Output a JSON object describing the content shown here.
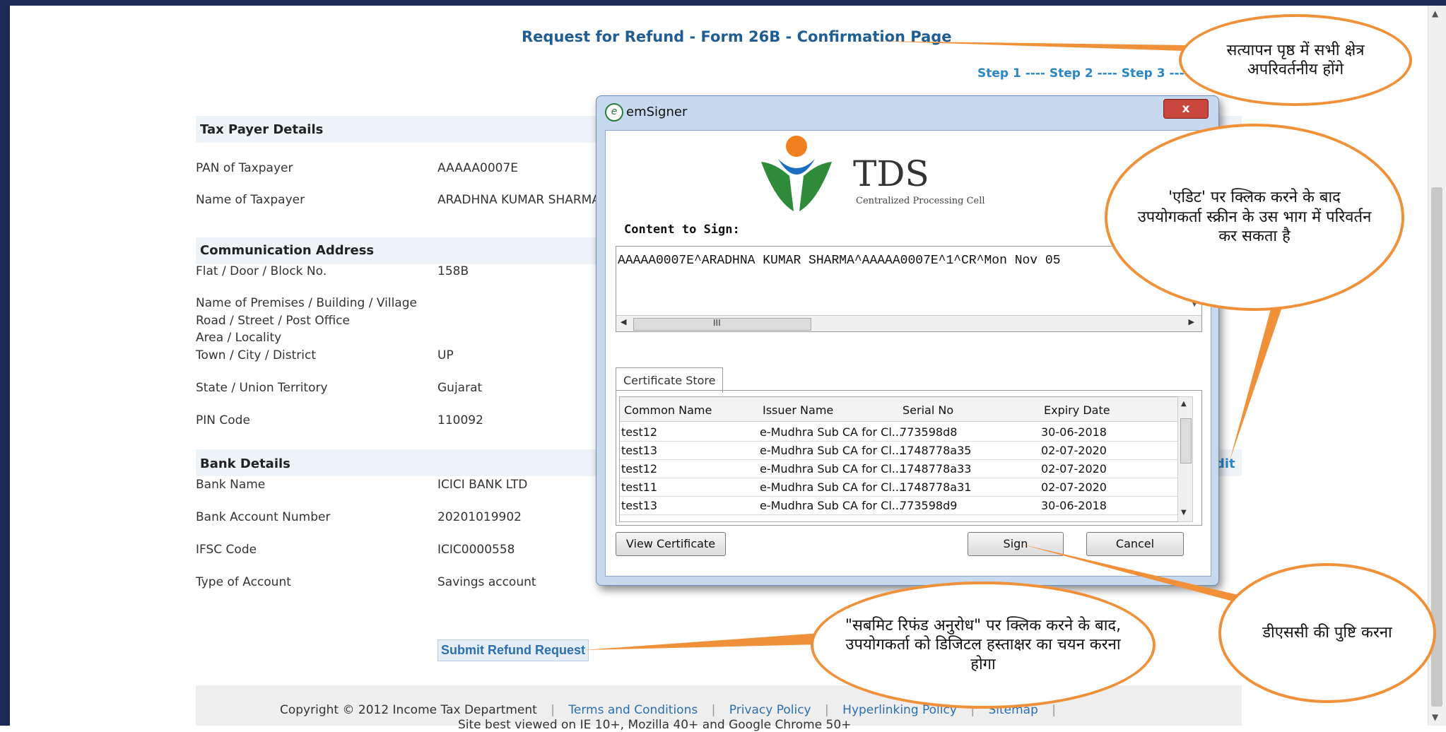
{
  "page": {
    "title": "Request for Refund - Form 26B - Confirmation Page",
    "steps": "Step 1 ---- Step 2 ---- Step 3 ----"
  },
  "taxpayer": {
    "heading": "Tax Payer Details",
    "pan_label": "PAN of Taxpayer",
    "pan_value": "AAAAA0007E",
    "name_label": "Name of Taxpayer",
    "name_value": "ARADHNA KUMAR SHARMA"
  },
  "address": {
    "heading": "Communication Address",
    "flat_label": "Flat / Door / Block No.",
    "flat_value": "158B",
    "premises_label": "Name of Premises / Building / Village",
    "road_label": "Road / Street / Post Office",
    "area_label": "Area / Locality",
    "town_label": "Town / City / District",
    "town_value": "UP",
    "state_label": "State / Union Territory",
    "state_value": "Gujarat",
    "pin_label": "PIN Code",
    "pin_value": "110092"
  },
  "bank": {
    "heading": "Bank Details",
    "edit_label": "dit",
    "name_label": "Bank Name",
    "name_value": "ICICI BANK LTD",
    "account_label": "Bank Account Number",
    "account_value": "20201019902",
    "ifsc_label": "IFSC Code",
    "ifsc_value": "ICIC0000558",
    "type_label": "Type of Account",
    "type_value": "Savings account"
  },
  "submit_label": "Submit Refund Request",
  "footer": {
    "copyright": "Copyright © 2012 Income Tax Department",
    "terms": "Terms and Conditions",
    "privacy": "Privacy Policy",
    "hyperlinking": "Hyperlinking Policy",
    "sitemap": "Sitemap",
    "best_viewed": "Site best viewed on IE 10+, Mozilla 40+ and Google Chrome 50+"
  },
  "dialog": {
    "title": "emSigner",
    "close": "x",
    "logo_text": "TDS",
    "logo_sub": "Centralized Processing Cell",
    "content_label": "Content to Sign:",
    "content_value": "AAAAA0007E^ARADHNA KUMAR SHARMA^AAAAA0007E^1^CR^Mon Nov 05",
    "scroll_grip": "III",
    "tab_label": "Certificate Store",
    "columns": [
      "Common Name",
      "Issuer Name",
      "Serial No",
      "Expiry Date"
    ],
    "rows": [
      [
        "test12",
        "e-Mudhra Sub CA for Cl...",
        "773598d8",
        "30-06-2018"
      ],
      [
        "test13",
        "e-Mudhra Sub CA for Cl...",
        "1748778a35",
        "02-07-2020"
      ],
      [
        "test12",
        "e-Mudhra Sub CA for Cl...",
        "1748778a33",
        "02-07-2020"
      ],
      [
        "test11",
        "e-Mudhra Sub CA for Cl...",
        "1748778a31",
        "02-07-2020"
      ],
      [
        "test13",
        "e-Mudhra Sub CA for Cl...",
        "773598d9",
        "30-06-2018"
      ]
    ],
    "view_cert": "View Certificate",
    "sign": "Sign",
    "cancel": "Cancel"
  },
  "callouts": {
    "top": "सत्यापन पृष्ठ में सभी क्षेत्र अपरिवर्तनीय होंगे",
    "edit": "'एडिट' पर क्लिक करने के बाद उपयोगकर्ता स्क्रीन के उस भाग में परिवर्तन कर सकता है",
    "submit": "\"सबमिट रिफंड अनुरोध\" पर क्लिक करने के बाद, उपयोगकर्ता को डिजिटल हस्ताक्षर का चयन करना होगा",
    "dsc": "डीएससी की पुष्टि करना"
  },
  "colors": {
    "accent": "#2b86c5",
    "callout_border": "#f0913a",
    "frame": "#1b2a55"
  }
}
